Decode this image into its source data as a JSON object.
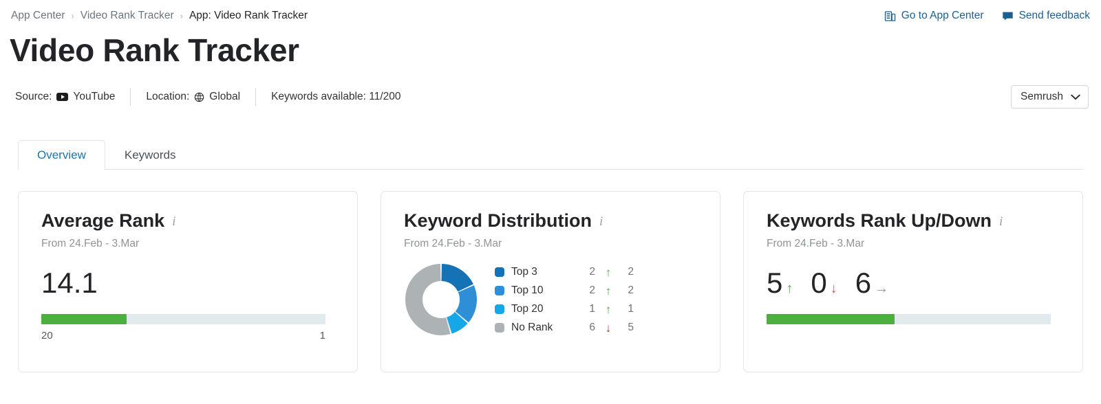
{
  "breadcrumb": {
    "items": [
      {
        "label": "App Center",
        "current": false
      },
      {
        "label": "Video Rank Tracker",
        "current": false
      },
      {
        "label": "App: Video Rank Tracker",
        "current": true
      }
    ],
    "separator": "›"
  },
  "top_actions": {
    "app_center": {
      "label": "Go to App Center",
      "icon": "app-card-icon"
    },
    "feedback": {
      "label": "Send feedback",
      "icon": "speech-bubble-icon"
    },
    "link_color": "#1b5f8f"
  },
  "page_title": "Video Rank Tracker",
  "meta": {
    "source_label": "Source:",
    "source_value": "YouTube",
    "source_icon": "youtube-icon",
    "location_label": "Location:",
    "location_value": "Global",
    "location_icon": "globe-icon",
    "keywords_available": "Keywords available: 11/200"
  },
  "account_select": {
    "value": "Semrush",
    "icon": "chevron-down-icon"
  },
  "tabs": [
    {
      "label": "Overview",
      "active": true
    },
    {
      "label": "Keywords",
      "active": false
    }
  ],
  "cards": {
    "average_rank": {
      "title": "Average Rank",
      "info_icon": "info-icon",
      "subtitle": "From 24.Feb - 3.Mar",
      "value": "14.1",
      "bar_fill_percent": 30,
      "scale_left": "20",
      "scale_right": "1",
      "fill_color": "#4caf3f",
      "track_color": "#e3eaee"
    },
    "keyword_distribution": {
      "title": "Keyword Distribution",
      "info_icon": "info-icon",
      "subtitle": "From 24.Feb - 3.Mar",
      "legend": [
        {
          "label": "Top 3",
          "count": "2",
          "trend": "up",
          "delta": "2",
          "color": "#1472b5"
        },
        {
          "label": "Top 10",
          "count": "2",
          "trend": "up",
          "delta": "2",
          "color": "#2f8fd6"
        },
        {
          "label": "Top 20",
          "count": "1",
          "trend": "up",
          "delta": "1",
          "color": "#16a7e8"
        },
        {
          "label": "No Rank",
          "count": "6",
          "trend": "down",
          "delta": "5",
          "color": "#adb2b5"
        }
      ],
      "arrow_up": "↑",
      "arrow_down": "↓"
    },
    "keywords_rank_up_down": {
      "title": "Keywords Rank Up/Down",
      "info_icon": "info-icon",
      "subtitle": "From 24.Feb - 3.Mar",
      "up": {
        "value": "5",
        "arrow": "↑"
      },
      "down": {
        "value": "0",
        "arrow": "↓"
      },
      "flat": {
        "value": "6",
        "arrow": "→"
      },
      "bar_fill_percent": 45,
      "fill_color": "#4caf3f",
      "track_color": "#e3eaee"
    }
  },
  "chart_data": {
    "type": "pie",
    "title": "Keyword Distribution",
    "subtitle": "From 24.Feb - 3.Mar",
    "categories": [
      "Top 3",
      "Top 10",
      "Top 20",
      "No Rank"
    ],
    "values": [
      2,
      2,
      1,
      6
    ],
    "colors": [
      "#1472b5",
      "#2f8fd6",
      "#16a7e8",
      "#adb2b5"
    ],
    "changes": [
      2,
      2,
      1,
      -5
    ],
    "total": 11,
    "donut": true,
    "legend_position": "right"
  }
}
